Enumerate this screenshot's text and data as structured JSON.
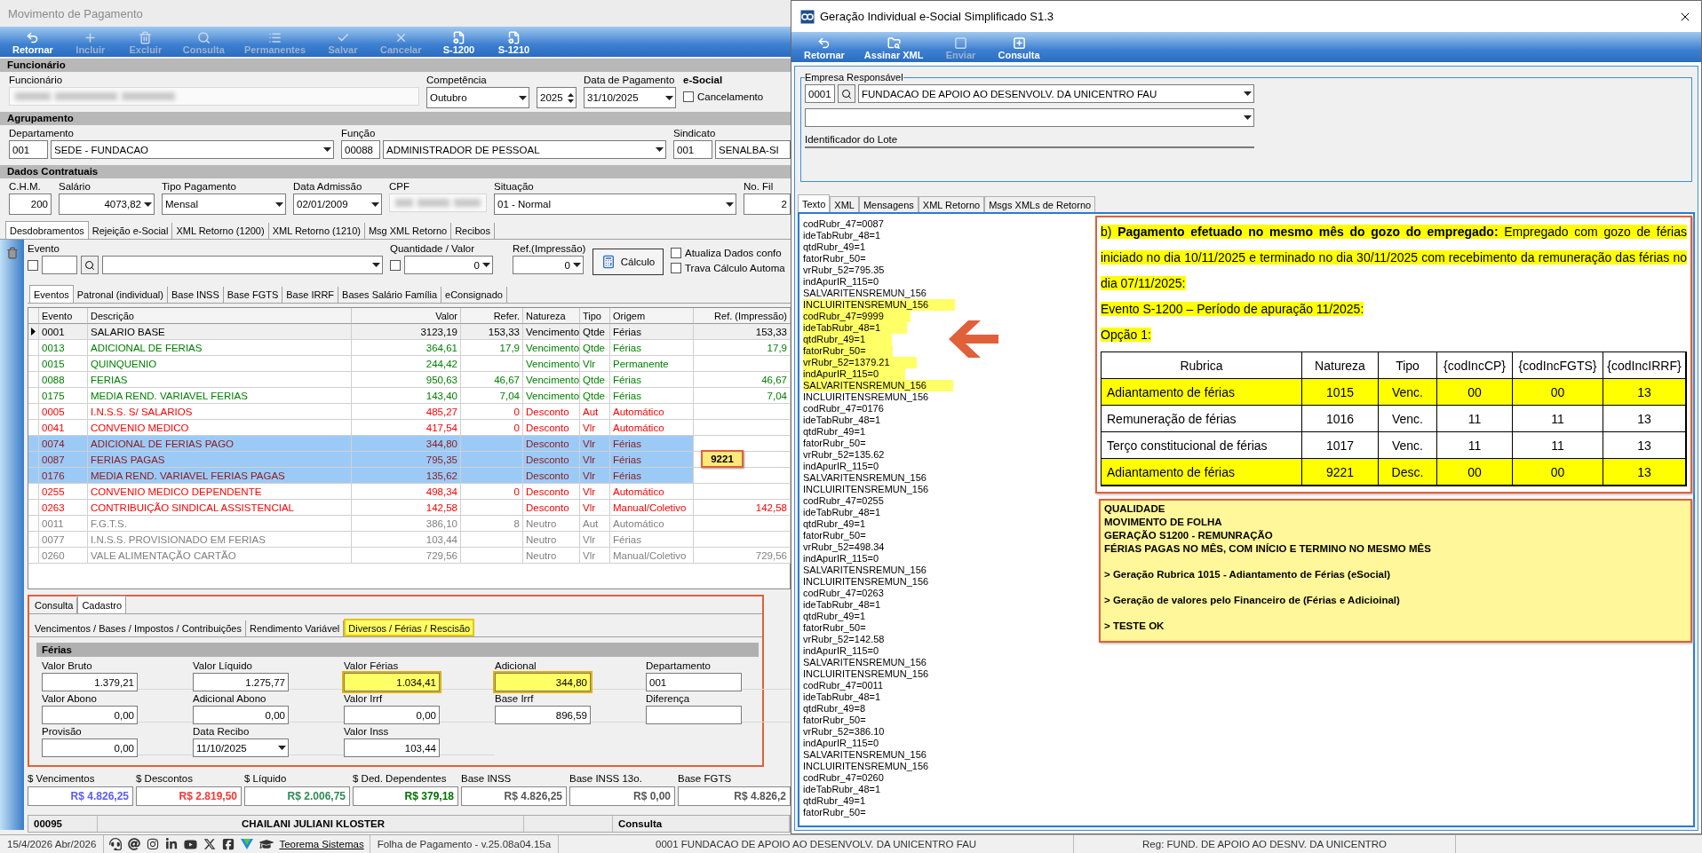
{
  "left_window": {
    "title": "Movimento de Pagamento",
    "toolbar": [
      {
        "label": "Retornar",
        "disabled": false
      },
      {
        "label": "Incluir",
        "disabled": true
      },
      {
        "label": "Excluir",
        "disabled": true
      },
      {
        "label": "Consulta",
        "disabled": true
      },
      {
        "label": "Permanentes",
        "disabled": true
      },
      {
        "label": "Salvar",
        "disabled": true
      },
      {
        "label": "Cancelar",
        "disabled": true
      },
      {
        "label": "S-1200",
        "disabled": false
      },
      {
        "label": "S-1210",
        "disabled": false
      }
    ],
    "sections": [
      {
        "title": "Funcionário",
        "fields": [
          {
            "label": "Funcionário",
            "kind": "blurred"
          },
          {
            "label": "Competência",
            "kind": "combo",
            "value": "Outubro"
          },
          {
            "kind": "spin",
            "value": "2025"
          },
          {
            "label": "Data de Pagamento",
            "kind": "combo",
            "value": "31/10/2025"
          },
          {
            "label": "e-Social",
            "kind": "check",
            "option": "Cancelamento",
            "checked": false
          }
        ]
      },
      {
        "title": "Agrupamento",
        "fields": [
          {
            "label": "Departamento",
            "kind": "coded",
            "code": "001",
            "value": "SEDE - FUNDACAO"
          },
          {
            "label": "Função",
            "kind": "coded",
            "code": "00088",
            "value": "ADMINISTRADOR DE PESSOAL"
          },
          {
            "label": "Sindicato",
            "kind": "coded_text",
            "code": "001",
            "value": "SENALBA-SI"
          }
        ]
      },
      {
        "title": "Dados Contratuais",
        "fields": [
          {
            "label": "C.H.M.",
            "kind": "number",
            "value": "200"
          },
          {
            "label": "Salário",
            "kind": "number_combo",
            "value": "4073,82"
          },
          {
            "label": "Tipo Pagamento",
            "kind": "combo",
            "value": "Mensal"
          },
          {
            "label": "Data Admissão",
            "kind": "combo",
            "value": "02/01/2009"
          },
          {
            "label": "CPF",
            "kind": "blurred"
          },
          {
            "label": "Situação",
            "kind": "combo",
            "value": "01 - Normal"
          },
          {
            "label": "No. Fil",
            "kind": "number",
            "value": "2"
          }
        ]
      }
    ],
    "tabs": [
      {
        "label": "Desdobramentos",
        "selected": true
      },
      {
        "label": "Rejeição e-Social",
        "selected": false
      },
      {
        "label": "XML Retorno (1200)",
        "selected": false
      },
      {
        "label": "XML Retorno (1210)",
        "selected": false
      },
      {
        "label": "Msg XML Retorno",
        "selected": false
      },
      {
        "label": "Recibos",
        "selected": false
      }
    ],
    "event_entry": {
      "evento_label": "Evento",
      "evento_checked": false,
      "quantidade_label": "Quantidade / Valor",
      "quantidade_checked": false,
      "quantidade": "0",
      "ref_label": "Ref.(Impressão)",
      "ref": "0",
      "calc_button": "Cálculo",
      "options": [
        {
          "label": "Atualiza Dados confo",
          "checked": false
        },
        {
          "label": "Trava Cálculo Automa",
          "checked": false
        }
      ]
    },
    "subtabs": [
      {
        "label": "Eventos",
        "selected": true
      },
      {
        "label": "Patronal (individual)",
        "selected": false
      },
      {
        "label": "Base INSS",
        "selected": false
      },
      {
        "label": "Base FGTS",
        "selected": false
      },
      {
        "label": "Base IRRF",
        "selected": false
      },
      {
        "label": "Bases Salário Família",
        "selected": false
      },
      {
        "label": "eConsignado",
        "selected": false
      }
    ],
    "table": {
      "columns": [
        "Evento",
        "Descrição",
        "Valor",
        "Refer.",
        "Natureza",
        "Tipo",
        "Origem",
        "Ref. (Impressão)"
      ],
      "rows": [
        {
          "evento": "0001",
          "descricao": "SALARIO BASE",
          "valor": "3123,19",
          "refer": "153,33",
          "natureza": "Vencimento",
          "tipo": "Qtde",
          "origem": "Férias",
          "ref_impressao": "153,33",
          "color": "#000000",
          "current": true,
          "selected": false
        },
        {
          "evento": "0013",
          "descricao": "ADICIONAL DE FERIAS",
          "valor": "364,61",
          "refer": "17,9",
          "natureza": "Vencimento",
          "tipo": "Qtde",
          "origem": "Férias",
          "ref_impressao": "17,9",
          "color": "#008000",
          "current": false,
          "selected": false
        },
        {
          "evento": "0015",
          "descricao": "QUINQUENIO",
          "valor": "244,42",
          "natureza": "Vencimento",
          "tipo": "Vlr",
          "origem": "Permanente",
          "color": "#008000",
          "current": false,
          "selected": false
        },
        {
          "evento": "0088",
          "descricao": "FERIAS",
          "valor": "950,63",
          "refer": "46,67",
          "natureza": "Vencimento",
          "tipo": "Qtde",
          "origem": "Férias",
          "ref_impressao": "46,67",
          "color": "#008000",
          "current": false,
          "selected": false
        },
        {
          "evento": "0175",
          "descricao": "MEDIA REND. VARIAVEL  FERIAS",
          "valor": "143,40",
          "refer": "7,04",
          "natureza": "Vencimento",
          "tipo": "Qtde",
          "origem": "Férias",
          "ref_impressao": "7,04",
          "color": "#008000",
          "current": false,
          "selected": false
        },
        {
          "evento": "0005",
          "descricao": "I.N.S.S. S/ SALARIOS",
          "valor": "485,27",
          "refer": "0",
          "natureza": "Desconto",
          "tipo": "Aut",
          "origem": "Automático",
          "color": "#ff0000",
          "current": false,
          "selected": false
        },
        {
          "evento": "0041",
          "descricao": "CONVENIO MEDICO",
          "valor": "417,54",
          "refer": "0",
          "natureza": "Desconto",
          "tipo": "Vlr",
          "origem": "Automático",
          "color": "#ff0000",
          "current": false,
          "selected": false
        },
        {
          "evento": "0074",
          "descricao": "ADICIONAL DE FERIAS PAGO",
          "valor": "344,80",
          "natureza": "Desconto",
          "tipo": "Vlr",
          "origem": "Férias",
          "color": "#8b1a1a",
          "current": false,
          "selected": true
        },
        {
          "evento": "0087",
          "descricao": "FERIAS PAGAS",
          "valor": "795,35",
          "natureza": "Desconto",
          "tipo": "Vlr",
          "origem": "Férias",
          "color": "#8b1a1a",
          "current": false,
          "selected": true
        },
        {
          "evento": "0176",
          "descricao": "MEDIA REND. VARIAVEL  FERIAS PAGAS",
          "valor": "135,62",
          "natureza": "Desconto",
          "tipo": "Vlr",
          "origem": "Férias",
          "color": "#8b1a1a",
          "current": false,
          "selected": true
        },
        {
          "evento": "0255",
          "descricao": "CONVENIO MEDICO DEPENDENTE",
          "valor": "498,34",
          "refer": "0",
          "natureza": "Desconto",
          "tipo": "Vlr",
          "origem": "Automático",
          "color": "#ff0000",
          "current": false,
          "selected": false
        },
        {
          "evento": "0263",
          "descricao": "CONTRIBUIÇÃO SINDICAL ASSISTENCIAL",
          "valor": "142,58",
          "natureza": "Desconto",
          "tipo": "Vlr",
          "origem": "Manual/Coletivo",
          "ref_impressao": "142,58",
          "color": "#ff0000",
          "current": false,
          "selected": false
        },
        {
          "evento": "0011",
          "descricao": "F.G.T.S.",
          "valor": "386,10",
          "refer": "8",
          "natureza": "Neutro",
          "tipo": "Aut",
          "origem": "Automático",
          "color": "#808080",
          "current": false,
          "selected": false
        },
        {
          "evento": "0077",
          "descricao": "I.N.S.S. PROVISIONADO EM FERIAS",
          "valor": "103,44",
          "natureza": "Neutro",
          "tipo": "Vlr",
          "origem": "Férias",
          "color": "#808080",
          "current": false,
          "selected": false
        },
        {
          "evento": "0260",
          "descricao": "VALE ALIMENTAÇÃO CARTÃO",
          "valor": "729,56",
          "natureza": "Neutro",
          "tipo": "Vlr",
          "origem": "Manual/Coletivo",
          "ref_impressao": "729,56",
          "color": "#808080",
          "current": false,
          "selected": false
        }
      ],
      "callout": "9221"
    },
    "detail": {
      "tabs": [
        {
          "label": "Consulta",
          "selected": false
        },
        {
          "label": "Cadastro",
          "selected": true
        }
      ],
      "subtabs": [
        {
          "label": "Vencimentos / Bases / Impostos / Contribuições",
          "selected": false
        },
        {
          "label": "Rendimento Variável",
          "selected": false
        },
        {
          "label": "Diversos / Férias / Rescisão",
          "selected": true
        }
      ],
      "group": "Férias",
      "fields": [
        {
          "label": "Valor Bruto",
          "value": "1.379,21",
          "kind": "number",
          "highlighted": false
        },
        {
          "label": "Valor Líquido",
          "value": "1.275,77",
          "kind": "number",
          "highlighted": false
        },
        {
          "label": "Valor Férias",
          "value": "1.034,41",
          "kind": "number",
          "highlighted": true
        },
        {
          "label": "Adicional",
          "value": "344,80",
          "kind": "number",
          "highlighted": true
        },
        {
          "label": "Departamento",
          "value": "001",
          "kind": "text",
          "highlighted": false
        },
        {
          "label": "Valor Abono",
          "value": "0,00",
          "kind": "number",
          "highlighted": false
        },
        {
          "label": "Adicional Abono",
          "value": "0,00",
          "kind": "number",
          "highlighted": false
        },
        {
          "label": "Valor Irrf",
          "value": "0,00",
          "kind": "number",
          "highlighted": false
        },
        {
          "label": "Base Irrf",
          "value": "896,59",
          "kind": "number",
          "highlighted": false
        },
        {
          "label": "Diferença",
          "kind": "text",
          "highlighted": false
        },
        {
          "label": "Provisão",
          "value": "0,00",
          "kind": "number",
          "highlighted": false
        },
        {
          "label": "Data Recibo",
          "value": "11/10/2025",
          "kind": "combo",
          "highlighted": false
        },
        {
          "label": "Valor Inss",
          "value": "103,44",
          "kind": "number",
          "highlighted": false
        }
      ]
    },
    "totals": [
      {
        "label": "$ Vencimentos",
        "value": "R$ 4.826,25",
        "color": "#5a5aff"
      },
      {
        "label": "$ Descontos",
        "value": "R$ 2.819,50",
        "color": "#ff3333"
      },
      {
        "label": "$ Líquido",
        "value": "R$ 2.006,75",
        "color": "#2e8b57"
      },
      {
        "label": "$ Ded. Dependentes",
        "value": "R$ 379,18",
        "color": "#007000"
      },
      {
        "label": "Base INSS",
        "value": "R$ 4.826,25",
        "color": "#555555"
      },
      {
        "label": "Base INSS 13o.",
        "value": "R$ 0,00",
        "color": "#555555"
      },
      {
        "label": "Base FGTS",
        "value": "R$ 4.826,2",
        "color": "#555555"
      }
    ],
    "record": {
      "code": "00095",
      "name": "CHAILANI JULIANI KLOSTER",
      "mode": "Consulta"
    }
  },
  "right_window": {
    "title": "Geração Individual e-Social Simplificado S1.3",
    "toolbar": [
      {
        "label": "Retornar",
        "disabled": false
      },
      {
        "label": "Assinar XML",
        "disabled": false
      },
      {
        "label": "Enviar",
        "disabled": true
      },
      {
        "label": "Consulta",
        "disabled": false
      }
    ],
    "group_title": "Empresa Responsável",
    "empresa_code": "0001",
    "empresa": "FUNDACAO DE APOIO AO DESENVOLV. DA UNICENTRO FAU",
    "lote_label": "Identificador do Lote",
    "tabs": [
      {
        "label": "Texto",
        "selected": true
      },
      {
        "label": "XML",
        "selected": false
      },
      {
        "label": "Mensagens",
        "selected": false
      },
      {
        "label": "XML Retorno",
        "selected": false
      },
      {
        "label": "Msgs XMLs de Retorno",
        "selected": false
      }
    ],
    "text_lines": [
      {
        "text": "codRubr_47=0087",
        "highlighted": false
      },
      {
        "text": "ideTabRubr_48=1",
        "highlighted": false
      },
      {
        "text": "qtdRubr_49=1",
        "highlighted": false
      },
      {
        "text": "fatorRubr_50=",
        "highlighted": false
      },
      {
        "text": "vrRubr_52=795.35",
        "highlighted": false
      },
      {
        "text": "indApurIR_115=0",
        "highlighted": false
      },
      {
        "text": "SALVARITENSREMUN_156",
        "highlighted": false
      },
      {
        "text": "INCLUIRITENSREMUN_156",
        "highlighted": true
      },
      {
        "text": "codRubr_47=9999",
        "highlighted": true
      },
      {
        "text": "ideTabRubr_48=1",
        "highlighted": true
      },
      {
        "text": "qtdRubr_49=1",
        "highlighted": true
      },
      {
        "text": "fatorRubr_50=",
        "highlighted": true
      },
      {
        "text": "vrRubr_52=1379.21",
        "highlighted": true
      },
      {
        "text": "indApurIR_115=0",
        "highlighted": true
      },
      {
        "text": "SALVARITENSREMUN_156",
        "highlighted": true
      },
      {
        "text": "INCLUIRITENSREMUN_156",
        "highlighted": false
      },
      {
        "text": "codRubr_47=0176",
        "highlighted": false
      },
      {
        "text": "ideTabRubr_48=1",
        "highlighted": false
      },
      {
        "text": "qtdRubr_49=1",
        "highlighted": false
      },
      {
        "text": "fatorRubr_50=",
        "highlighted": false
      },
      {
        "text": "vrRubr_52=135.62",
        "highlighted": false
      },
      {
        "text": "indApurIR_115=0",
        "highlighted": false
      },
      {
        "text": "SALVARITENSREMUN_156",
        "highlighted": false
      },
      {
        "text": "INCLUIRITENSREMUN_156",
        "highlighted": false
      },
      {
        "text": "codRubr_47=0255",
        "highlighted": false
      },
      {
        "text": "ideTabRubr_48=1",
        "highlighted": false
      },
      {
        "text": "qtdRubr_49=1",
        "highlighted": false
      },
      {
        "text": "fatorRubr_50=",
        "highlighted": false
      },
      {
        "text": "vrRubr_52=498.34",
        "highlighted": false
      },
      {
        "text": "indApurIR_115=0",
        "highlighted": false
      },
      {
        "text": "SALVARITENSREMUN_156",
        "highlighted": false
      },
      {
        "text": "INCLUIRITENSREMUN_156",
        "highlighted": false
      },
      {
        "text": "codRubr_47=0263",
        "highlighted": false
      },
      {
        "text": "ideTabRubr_48=1",
        "highlighted": false
      },
      {
        "text": "qtdRubr_49=1",
        "highlighted": false
      },
      {
        "text": "fatorRubr_50=",
        "highlighted": false
      },
      {
        "text": "vrRubr_52=142.58",
        "highlighted": false
      },
      {
        "text": "indApurIR_115=0",
        "highlighted": false
      },
      {
        "text": "SALVARITENSREMUN_156",
        "highlighted": false
      },
      {
        "text": "INCLUIRITENSREMUN_156",
        "highlighted": false
      },
      {
        "text": "codRubr_47=0011",
        "highlighted": false
      },
      {
        "text": "ideTabRubr_48=1",
        "highlighted": false
      },
      {
        "text": "qtdRubr_49=8",
        "highlighted": false
      },
      {
        "text": "fatorRubr_50=",
        "highlighted": false
      },
      {
        "text": "vrRubr_52=386.10",
        "highlighted": false
      },
      {
        "text": "indApurIR_115=0",
        "highlighted": false
      },
      {
        "text": "SALVARITENSREMUN_156",
        "highlighted": false
      },
      {
        "text": "INCLUIRITENSREMUN_156",
        "highlighted": false
      },
      {
        "text": "codRubr_47=0260",
        "highlighted": false
      },
      {
        "text": "ideTabRubr_48=1",
        "highlighted": false
      },
      {
        "text": "qtdRubr_49=1",
        "highlighted": false
      },
      {
        "text": "fatorRubr_50=",
        "highlighted": false
      }
    ],
    "annotation": {
      "paragraph": "b) **Pagamento efetuado no mesmo mês do gozo do empregado:** Empregado com gozo de férias iniciado no dia 10/11/2025 e terminado no dia 30/11/2025 com recebimento da remuneração das férias no dia 07/11/2025:",
      "lines": [
        "Evento S-1200 – Período de apuração 11/2025:",
        "Opção 1:"
      ],
      "table": {
        "columns": [
          "Rubrica",
          "Natureza",
          "Tipo",
          "{codIncCP}",
          "{codIncFGTS}",
          "{codIncIRRF}"
        ],
        "rows": [
          {
            "cells": [
              "Adiantamento de férias",
              "1015",
              "Venc.",
              "00",
              "00",
              "13"
            ],
            "highlighted": true
          },
          {
            "cells": [
              "Remuneração de férias",
              "1016",
              "Venc.",
              "11",
              "11",
              "13"
            ],
            "highlighted": false
          },
          {
            "cells": [
              "Terço constitucional de férias",
              "1017",
              "Venc.",
              "11",
              "11",
              "13"
            ],
            "highlighted": false
          },
          {
            "cells": [
              "Adiantamento de férias",
              "9221",
              "Desc.",
              "00",
              "00",
              "13"
            ],
            "highlighted": true
          }
        ]
      }
    },
    "note": [
      {
        "text": "QUALIDADE",
        "kind": "heading"
      },
      {
        "text": "MOVIMENTO DE FOLHA",
        "kind": "heading"
      },
      {
        "text": "GERAÇÃO S1200 - REMUNRAÇÃO",
        "kind": "heading"
      },
      {
        "text": "FÉRIAS PAGAS NO MÊS, COM INÍCIO E TERMINO NO MESMO MÊS",
        "kind": "heading"
      },
      {
        "text": "> Geração Rubrica 1015 - Adiantamento de Férias (eSocial)",
        "kind": "step"
      },
      {
        "text": "> Geração de valores pelo Financeiro de (Férias e Adicioinal)",
        "kind": "step"
      },
      {
        "text": "> TESTE OK",
        "kind": "step"
      }
    ]
  },
  "status_bar": {
    "date": "15/4/2026 Abr/2026",
    "link": "Teorema Sistemas",
    "app": "Folha de Pagamento - v.25.08a04.15a",
    "company": "0001 FUNDACAO DE APOIO AO DESENVOLV. DA UNICENTRO FAU",
    "reg": "Reg: FUND. DE APOIO AO DESNV. DA UNICENTRO"
  }
}
